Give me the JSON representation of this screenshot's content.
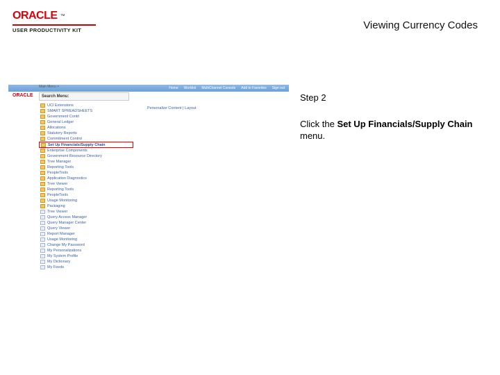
{
  "brand": {
    "name": "ORACLE",
    "tm": "™",
    "sub": "USER PRODUCTIVITY KIT"
  },
  "page": {
    "title": "Viewing Currency Codes"
  },
  "instructions": {
    "step": "Step 2",
    "line1_pre": "Click the ",
    "line1_bold": "Set Up Financials/Supply Chain",
    "line1_post": " menu."
  },
  "shot": {
    "logo": "ORACLE",
    "toplinks": [
      "Home",
      "Worklist",
      "MultiChannel Console",
      "Add to Favorites",
      "Sign out"
    ],
    "mainmenu_label": "Main Menu >",
    "search_label": "Search Menu:",
    "content_hint": "Personalize Content | Layout",
    "menu_items": [
      {
        "label": "UCI Extensions",
        "type": "folder"
      },
      {
        "label": "SMART SPREADSHEETS",
        "type": "folder"
      },
      {
        "label": "Government Contrl",
        "type": "folder"
      },
      {
        "label": "General Ledger",
        "type": "folder"
      },
      {
        "label": "Allocations",
        "type": "folder"
      },
      {
        "label": "Statutory Reports",
        "type": "folder"
      },
      {
        "label": "Commitment Control",
        "type": "folder"
      },
      {
        "label": "Set Up Financials/Supply Chain",
        "type": "folder",
        "highlight": true
      },
      {
        "label": "Enterprise Components",
        "type": "folder"
      },
      {
        "label": "Government Resource Directory",
        "type": "folder"
      },
      {
        "label": "Tree Manager",
        "type": "folder"
      },
      {
        "label": "Reporting Tools",
        "type": "folder"
      },
      {
        "label": "PeopleTools",
        "type": "folder"
      },
      {
        "label": "Application Diagnostics",
        "type": "folder"
      },
      {
        "label": "Tree Viewer",
        "type": "folder"
      },
      {
        "label": "Reporting Tools",
        "type": "folder"
      },
      {
        "label": "PeopleTools",
        "type": "folder"
      },
      {
        "label": "Usage Monitoring",
        "type": "folder"
      },
      {
        "label": "Packaging",
        "type": "folder"
      },
      {
        "label": "Tree Viewer",
        "type": "doc"
      },
      {
        "label": "Query Access Manager",
        "type": "doc"
      },
      {
        "label": "Query Manager Center",
        "type": "doc"
      },
      {
        "label": "Query Viewer",
        "type": "doc"
      },
      {
        "label": "Report Manager",
        "type": "doc"
      },
      {
        "label": "Usage Monitoring",
        "type": "doc"
      },
      {
        "label": "Change My Password",
        "type": "doc"
      },
      {
        "label": "My Personalizations",
        "type": "doc"
      },
      {
        "label": "My System Profile",
        "type": "doc"
      },
      {
        "label": "My Dictionary",
        "type": "doc"
      },
      {
        "label": "My Feeds",
        "type": "doc"
      }
    ]
  }
}
